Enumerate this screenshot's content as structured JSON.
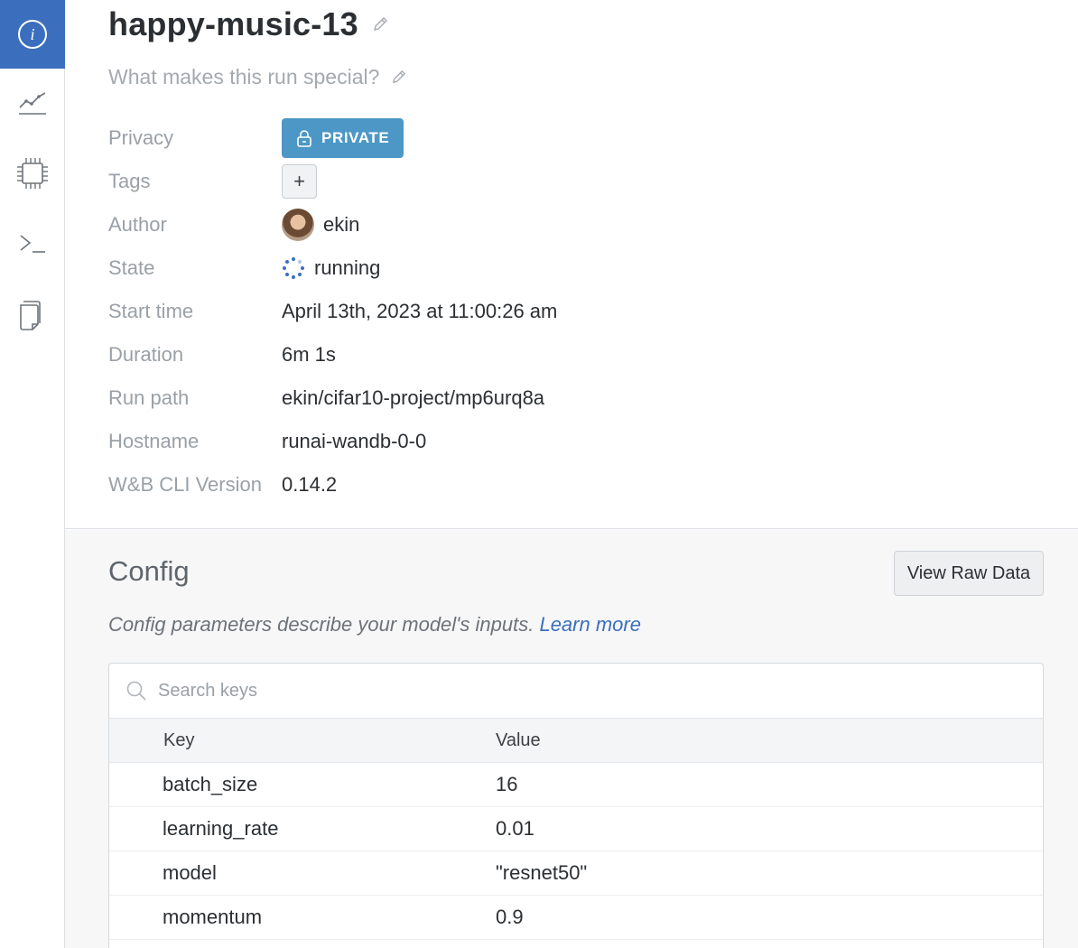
{
  "run": {
    "name": "happy-music-13",
    "description_placeholder": "What makes this run special?"
  },
  "meta": {
    "privacy_label": "Privacy",
    "privacy_value": "PRIVATE",
    "tags_label": "Tags",
    "tags_add": "+",
    "author_label": "Author",
    "author_value": "ekin",
    "state_label": "State",
    "state_value": "running",
    "start_label": "Start time",
    "start_value": "April 13th, 2023 at 11:00:26 am",
    "duration_label": "Duration",
    "duration_value": "6m 1s",
    "path_label": "Run path",
    "path_value": "ekin/cifar10-project/mp6urq8a",
    "host_label": "Hostname",
    "host_value": "runai-wandb-0-0",
    "cli_label": "W&B CLI Version",
    "cli_value": "0.14.2"
  },
  "config": {
    "title": "Config",
    "raw_button": "View Raw Data",
    "description": "Config parameters describe your model's inputs.",
    "learn_more": "Learn more",
    "search_placeholder": "Search keys",
    "columns": {
      "key": "Key",
      "value": "Value"
    },
    "rows": [
      {
        "key": "batch_size",
        "value": "16"
      },
      {
        "key": "learning_rate",
        "value": "0.01"
      },
      {
        "key": "model",
        "value": "\"resnet50\""
      },
      {
        "key": "momentum",
        "value": "0.9"
      }
    ]
  },
  "colors": {
    "accent": "#3b6fbd",
    "private_badge": "#4c97c6",
    "label_gray": "#9aa0a7"
  },
  "sidebar": {
    "items": [
      {
        "icon": "info-icon",
        "active": true
      },
      {
        "icon": "chart-icon",
        "active": false
      },
      {
        "icon": "chip-icon",
        "active": false
      },
      {
        "icon": "terminal-icon",
        "active": false
      },
      {
        "icon": "files-icon",
        "active": false
      }
    ]
  }
}
